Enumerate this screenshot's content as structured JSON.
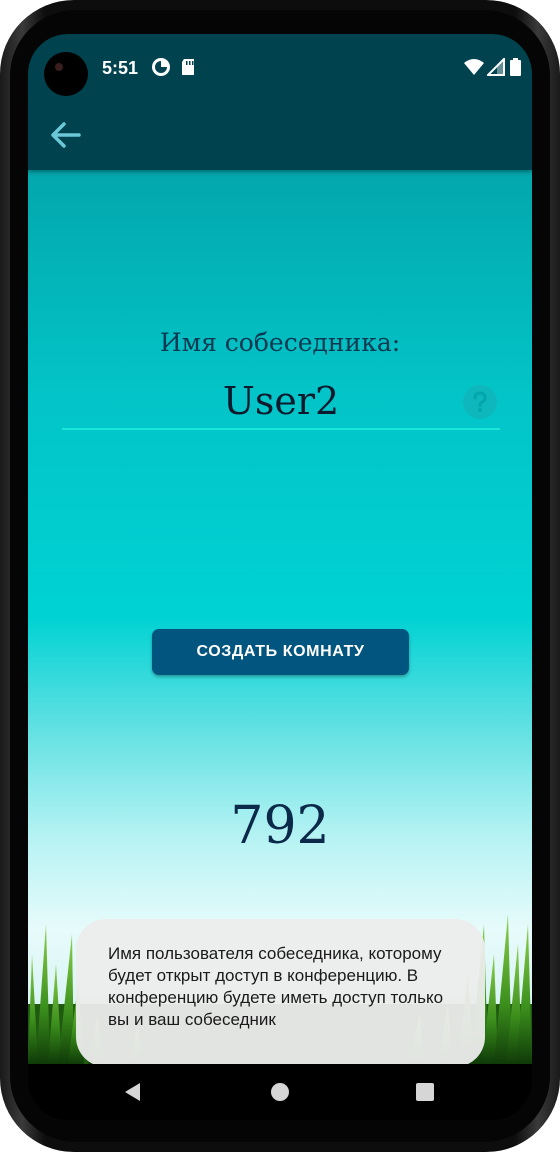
{
  "status_bar": {
    "time": "5:51",
    "icons": [
      "camera-cutout",
      "data-saver-icon",
      "sd-card-icon",
      "wifi-icon",
      "signal-icon",
      "battery-icon"
    ]
  },
  "app_bar": {
    "back_icon": "arrow-left-icon"
  },
  "form": {
    "label": "Имя собеседника:",
    "name_value": "User2",
    "help_icon": "question-circle-icon",
    "underline_color": "#18e6d8"
  },
  "actions": {
    "create_room_label": "СОЗДАТЬ КОМНАТУ"
  },
  "room": {
    "number": "792"
  },
  "toast": {
    "text": "Имя пользователя собеседника, которому будет открыт доступ в конференцию. В конференцию будете иметь доступ только вы и ваш собеседник"
  },
  "nav_bar": {
    "icons": [
      "back-triangle-icon",
      "home-circle-icon",
      "recents-square-icon"
    ]
  },
  "colors": {
    "app_bar": "#00434f",
    "button": "#01557f",
    "accent": "#18e6d8"
  }
}
